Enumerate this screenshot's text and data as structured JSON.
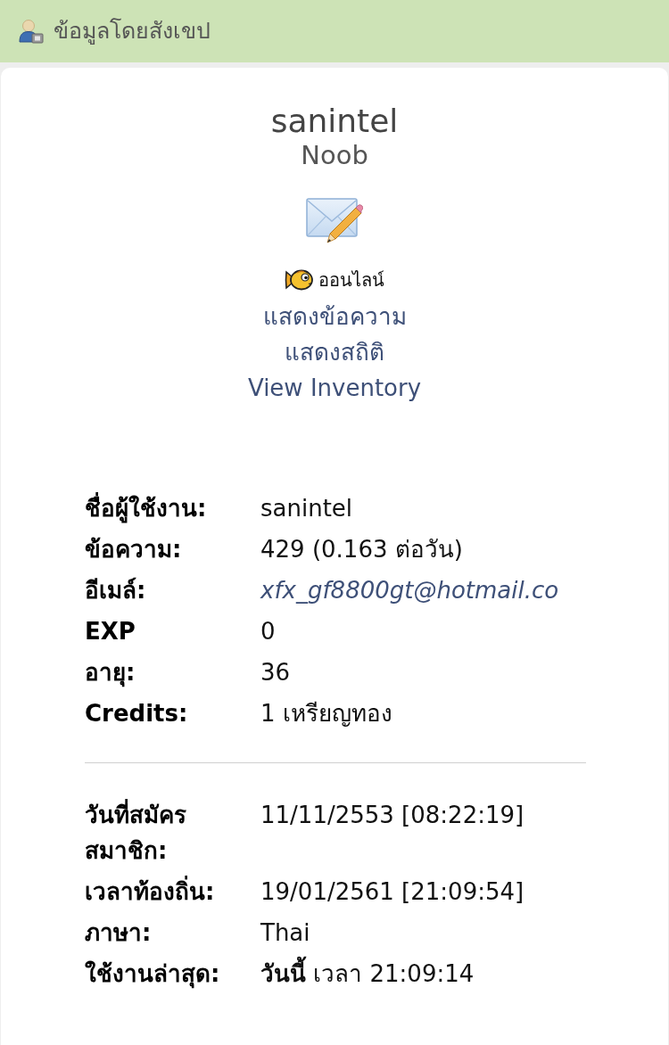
{
  "header": {
    "title": "ข้อมูลโดยสังเขป"
  },
  "profile": {
    "username": "sanintel",
    "rank": "Noob",
    "status": "ออนไลน์",
    "links": [
      "แสดงข้อความ",
      "แสดงสถิติ",
      "View Inventory"
    ]
  },
  "details": [
    {
      "rows": [
        {
          "label": "ชื่อผู้ใช้งาน:",
          "value": "sanintel",
          "kind": "text"
        },
        {
          "label": "ข้อความ:",
          "value": "429 (0.163 ต่อวัน)",
          "kind": "text"
        },
        {
          "label": "อีเมล์:",
          "value": "xfx_gf8800gt@hotmail.co",
          "kind": "link"
        },
        {
          "label": "EXP",
          "value": "0",
          "kind": "text"
        },
        {
          "label": "อายุ:",
          "value": "36",
          "kind": "text"
        },
        {
          "label": "Credits:",
          "value": "1 เหรียญทอง",
          "kind": "text"
        }
      ]
    },
    {
      "rows": [
        {
          "label": "วันที่สมัครสมาชิก:",
          "value": "11/11/2553 [08:22:19]",
          "kind": "text"
        },
        {
          "label": "เวลาท้องถิ่น:",
          "value": "19/01/2561 [21:09:54]",
          "kind": "text"
        },
        {
          "label": "ภาษา:",
          "value": "Thai",
          "kind": "text"
        },
        {
          "label": "ใช้งานล่าสุด:",
          "value": "**วันนี้** เวลา 21:09:14",
          "kind": "text"
        }
      ]
    }
  ]
}
